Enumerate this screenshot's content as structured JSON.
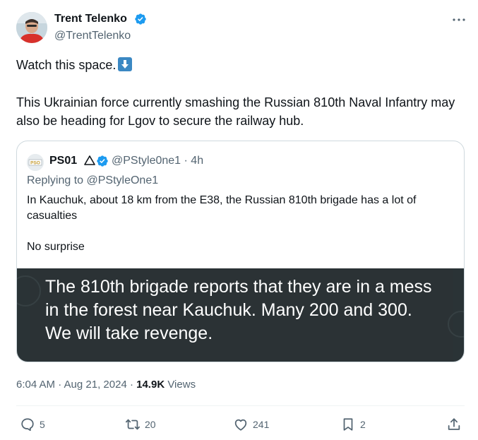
{
  "author": {
    "name": "Trent Telenko",
    "handle": "@TrentTelenko",
    "verified": true
  },
  "tweet": {
    "line1": "Watch this space.",
    "line1_emoji": "down-arrow-emoji",
    "body": "This Ukrainian force currently smashing the Russian 810th Naval Infantry may also be heading for Lgov to secure the railway hub."
  },
  "quote": {
    "avatar_text": "PSO",
    "name": "PS01",
    "handle_time": "@PStyle0ne1 · 4h",
    "replying_prefix": "Replying to ",
    "replying_to": "@PStyleOne1",
    "text": "In Kauchuk, about 18 km from the E38, the Russian 810th brigade has a lot of casualties\n\nNo surprise",
    "image_caption": "The 810th brigade reports that they are in a mess in the forest near Kauchuk. Many 200 and 300. We will take revenge."
  },
  "meta": {
    "timestamp": "6:04 AM · Aug 21, 2024 · ",
    "views_count": "14.9K",
    "views_label": " Views"
  },
  "actions": {
    "replies": "5",
    "reposts": "20",
    "likes": "241",
    "bookmarks": "2"
  },
  "colors": {
    "verified": "#1d9bf0",
    "secondary_text": "#536471",
    "border": "#cfd9de"
  }
}
